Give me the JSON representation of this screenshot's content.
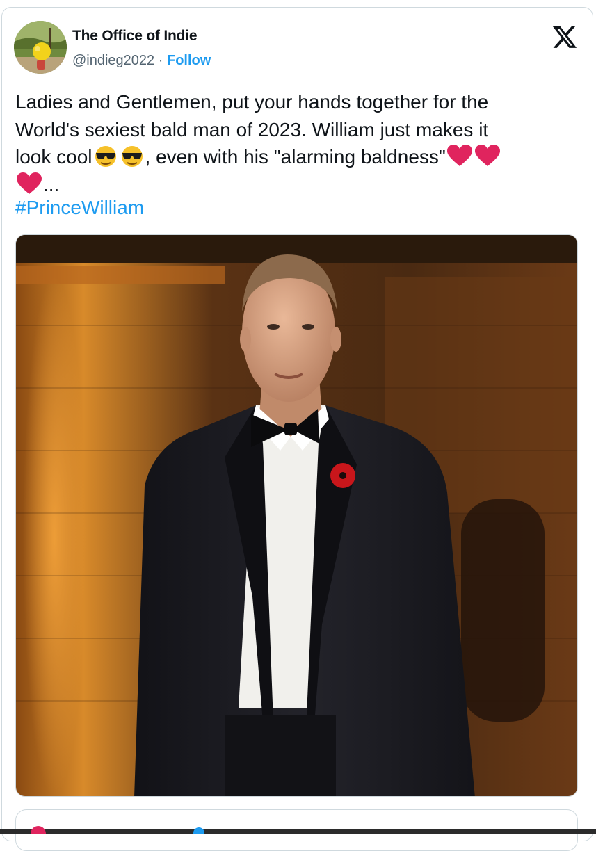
{
  "author": {
    "display_name": "The Office of Indie",
    "handle": "@indieg2022",
    "separator": "·",
    "follow_label": "Follow"
  },
  "tweet": {
    "line1": "Ladies and Gentlemen, put your hands together for the",
    "line2": "World's sexiest bald man of 2023. William just makes it",
    "line3_a": "look cool",
    "line3_b": ", even with his \"alarming baldness\"",
    "line4_ellipsis": "...",
    "hashtag": "#PrinceWilliam",
    "emojis": [
      "sunglasses-emoji",
      "sunglasses-emoji",
      "red-heart-emoji",
      "red-heart-emoji",
      "red-heart-emoji"
    ]
  },
  "icons": {
    "platform_logo": "x-logo-icon"
  },
  "colors": {
    "link_blue": "#1d9bf0",
    "text": "#0f1419",
    "secondary_text": "#536471",
    "border": "#cfd9de",
    "heart_red": "#e0245e"
  }
}
